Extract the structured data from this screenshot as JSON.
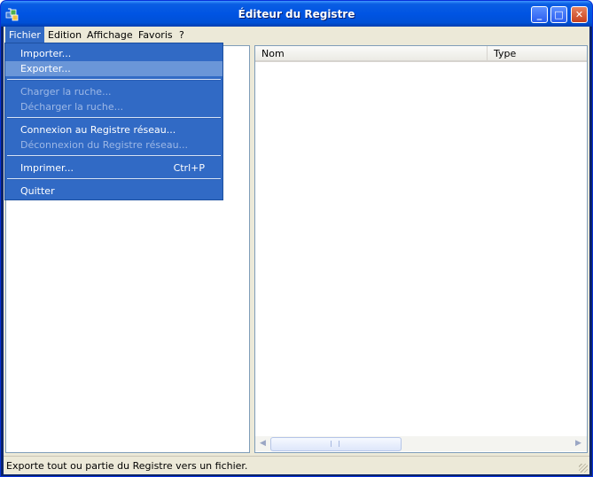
{
  "window": {
    "title": "Éditeur du Registre",
    "app_icon": "registry-editor-icon"
  },
  "caption_buttons": {
    "minimize": "_",
    "maximize": "□",
    "close": "✕"
  },
  "menubar": [
    {
      "label": "Fichier"
    },
    {
      "label": "Edition"
    },
    {
      "label": "Affichage"
    },
    {
      "label": "Favoris"
    },
    {
      "label": "?"
    }
  ],
  "file_menu": {
    "items": [
      {
        "label": "Importer...",
        "enabled": true
      },
      {
        "label": "Exporter...",
        "enabled": true,
        "highlighted": true
      },
      {
        "label": "Charger la ruche...",
        "enabled": false
      },
      {
        "label": "Décharger la ruche...",
        "enabled": false
      },
      {
        "label": "Connexion au Registre réseau...",
        "enabled": true
      },
      {
        "label": "Déconnexion du Registre réseau...",
        "enabled": false
      },
      {
        "label": "Imprimer...",
        "enabled": true,
        "shortcut": "Ctrl+P"
      },
      {
        "label": "Quitter",
        "enabled": true
      }
    ]
  },
  "list": {
    "columns": [
      "Nom",
      "Type"
    ]
  },
  "statusbar": {
    "text": "Exporte tout ou partie du Registre vers un fichier."
  },
  "colors": {
    "title_bar": "#0054e3",
    "menu_highlight": "#316ac5",
    "dropdown_hover": "#6a96d8",
    "face": "#ece9d8"
  }
}
